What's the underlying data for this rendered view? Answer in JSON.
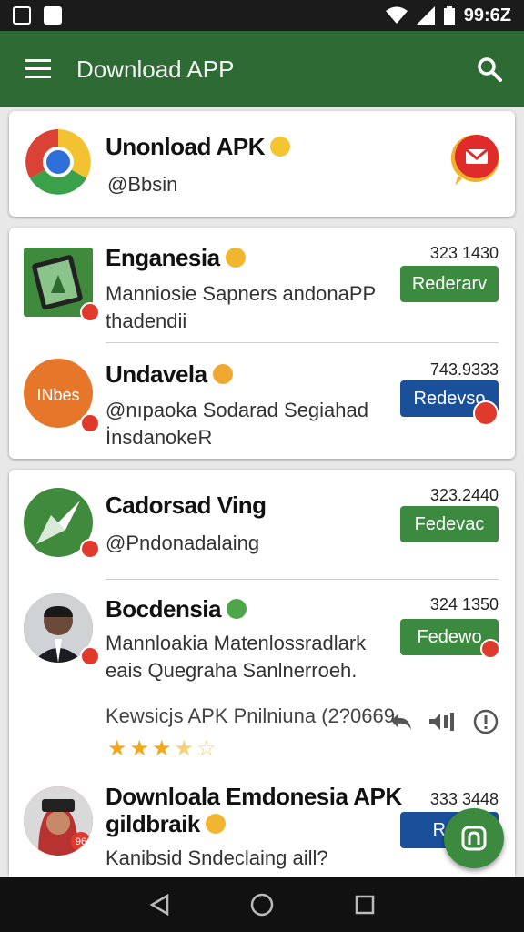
{
  "status_bar": {
    "time": "99:6Z"
  },
  "app_bar": {
    "title": "Download APP"
  },
  "header_card": {
    "title": "Unonload APK",
    "handle": "@Bbsin"
  },
  "group1": [
    {
      "name": "Enganesia",
      "line1": "Manniosie Sapners  andonaPP",
      "line2": "thadendii",
      "count": "323 1430",
      "button": "Rederarv",
      "button_style": "green"
    },
    {
      "name": "Undavela",
      "line1": "@nıpaoka Sodarad Segiahad",
      "line2": "İnsdanokeR",
      "count": "743.9333",
      "button": "Redevso",
      "button_style": "blue",
      "icon_text": "INbes"
    }
  ],
  "group2": [
    {
      "name": "Cadorsad Ving",
      "line1": "@Pndonadalaing",
      "count": "323.2440",
      "button": "Fedevac",
      "button_style": "green"
    },
    {
      "name": "Bocdensia",
      "line1": "Mannloakia Matenlossradlark",
      "line2": "eais Quegraha Sanlnerroeh.",
      "count": "324 1350",
      "button": "Fedewo",
      "button_style": "green"
    }
  ],
  "review": {
    "text": "Kewsicjs APK Pnilniuna (2?0669",
    "rating": 3.5
  },
  "group3": {
    "name_line1": "Downloala Emdonesia APK",
    "name_line2": "gildbraik",
    "sub": "Kanibsid Sndeclaing aill?",
    "count": "333 3448",
    "button": "Ran",
    "icon_text": "96"
  },
  "colors": {
    "appbar": "#2e6b34",
    "green_button": "#3b8a3f",
    "blue_button": "#1a4f9a",
    "badge": "#e03a2d"
  }
}
